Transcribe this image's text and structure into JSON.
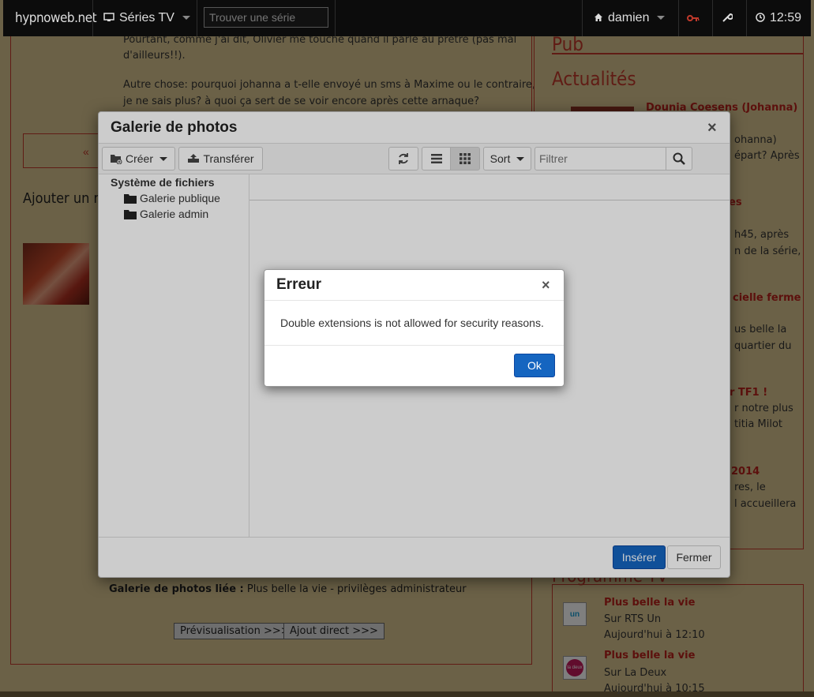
{
  "navbar": {
    "brand": "hypnoweb.net",
    "series_menu": "Séries TV",
    "search_placeholder": "Trouver une série",
    "user": "damien",
    "time": "12:59"
  },
  "article": {
    "line1": "Pourtant, comme j'ai dit, Olivier me touche quand il parle au prêtre (pas mal",
    "line2": "d'ailleurs!!).",
    "line3": "Autre chose: pourquoi johanna a t-elle envoyé un sms à Maxime ou le contraire,",
    "line4": "je ne sais plus? à quoi ça sert de se voir encore après cette arnaque?",
    "pager_prev": "«",
    "add_comment": "Ajouter un me",
    "linked_gallery_label": "Galerie de photos liée :",
    "linked_gallery_value": " Plus belle la vie - privilèges administrateur",
    "preview_button": "Prévisualisation >>>",
    "direct_button": "Ajout direct >>>"
  },
  "sidebar": {
    "pub_heading": "Pub",
    "news_heading": "Actualités",
    "news": [
      {
        "title": "Dounia Coesens (Johanna)",
        "text1": "ohanna)",
        "text2": "épart? Après"
      },
      {
        "title": "es",
        "text1": "h45, après",
        "text2": "n de la série,"
      },
      {
        "title": "cielle ferme",
        "text1": "us belle la",
        "text2": "quartier du"
      },
      {
        "title": "r TF1 !",
        "text1": "r notre plus",
        "text2": "titia Milot"
      },
      {
        "title": "2014",
        "text1": "res, le",
        "text2": "l accueillera"
      }
    ],
    "tv_heading": "Programme TV",
    "tv": [
      {
        "show": "Plus belle la vie",
        "channel": "Sur RTS Un",
        "time": "Aujourd'hui à 12:10",
        "logo": "un"
      },
      {
        "show": "Plus belle la vie",
        "channel": "Sur La Deux",
        "time": "Aujourd'hui à 10:15",
        "logo": "la deux"
      }
    ]
  },
  "gallery": {
    "title": "Galerie de photos",
    "close": "×",
    "create_button": "Créer",
    "upload_button": "Transférer",
    "sort_button": "Sort",
    "filter_placeholder": "Filtrer",
    "tree_root": "Système de fichiers",
    "folders": [
      "Galerie publique",
      "Galerie admin"
    ],
    "insert_button": "Insérer",
    "close_button": "Fermer"
  },
  "error_dialog": {
    "title": "Erreur",
    "close": "×",
    "message": "Double extensions is not allowed for security reasons.",
    "ok_button": "Ok"
  },
  "colors": {
    "accent_red": "#c0392b",
    "primary_blue": "#1565c0",
    "navbar_bg": "#0c0c0c",
    "page_bg": "#d7c38e"
  }
}
